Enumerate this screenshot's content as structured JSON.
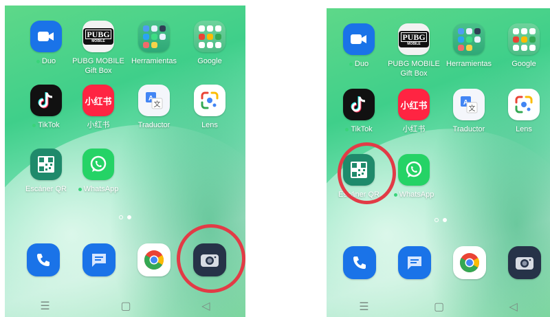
{
  "screens": [
    {
      "apps": [
        {
          "label": "Duo",
          "has_dot": true,
          "icon": "duo-video-icon"
        },
        {
          "label": "PUBG MOBILE\nGift Box",
          "has_dot": false,
          "icon": "pubg-logo-icon",
          "badge_text": "PUBG",
          "badge_sub": "MOBILE"
        },
        {
          "label": "Herramientas",
          "has_dot": false,
          "icon": "tools-folder-icon"
        },
        {
          "label": "Google",
          "has_dot": false,
          "icon": "google-folder-icon"
        },
        {
          "label": "TikTok",
          "has_dot": true,
          "icon": "tiktok-icon"
        },
        {
          "label": "小红书",
          "has_dot": false,
          "icon": "xiaohongshu-icon",
          "badge_text": "小红书"
        },
        {
          "label": "Traductor",
          "has_dot": false,
          "icon": "translate-icon"
        },
        {
          "label": "Lens",
          "has_dot": false,
          "icon": "lens-icon"
        },
        {
          "label": "Escáner QR",
          "has_dot": false,
          "icon": "qr-scanner-icon"
        },
        {
          "label": "WhatsApp",
          "has_dot": true,
          "icon": "whatsapp-icon"
        }
      ],
      "dock": [
        "phone-icon",
        "messages-icon",
        "chrome-icon",
        "camera-icon"
      ],
      "highlighted": "camera-icon"
    },
    {
      "apps": [
        {
          "label": "Duo",
          "has_dot": true,
          "icon": "duo-video-icon"
        },
        {
          "label": "PUBG MOBILE\nGift Box",
          "has_dot": false,
          "icon": "pubg-logo-icon",
          "badge_text": "PUBG",
          "badge_sub": "MOBILE"
        },
        {
          "label": "Herramientas",
          "has_dot": false,
          "icon": "tools-folder-icon"
        },
        {
          "label": "Google",
          "has_dot": false,
          "icon": "google-folder-icon"
        },
        {
          "label": "TikTok",
          "has_dot": true,
          "icon": "tiktok-icon"
        },
        {
          "label": "小红书",
          "has_dot": false,
          "icon": "xiaohongshu-icon",
          "badge_text": "小红书"
        },
        {
          "label": "Traductor",
          "has_dot": false,
          "icon": "translate-icon"
        },
        {
          "label": "Lens",
          "has_dot": false,
          "icon": "lens-icon"
        },
        {
          "label": "Escáner QR",
          "has_dot": false,
          "icon": "qr-scanner-icon"
        },
        {
          "label": "WhatsApp",
          "has_dot": true,
          "icon": "whatsapp-icon"
        }
      ],
      "dock": [
        "phone-icon",
        "messages-icon",
        "chrome-icon",
        "camera-icon"
      ],
      "highlighted": "qr-scanner-icon"
    }
  ],
  "nav_glyphs": {
    "recents": "☰",
    "home": "▢",
    "back": "◁"
  },
  "colors": {
    "highlight_ring": "#e23b46",
    "wallpaper": "#3fcf8a",
    "duo": "#1a73e8",
    "phone": "#1a73e8",
    "messages": "#1a73e8",
    "xiaohongshu": "#ff2442",
    "whatsapp": "#25d366",
    "camera": "#263248",
    "qr": "#1f8a6b"
  }
}
